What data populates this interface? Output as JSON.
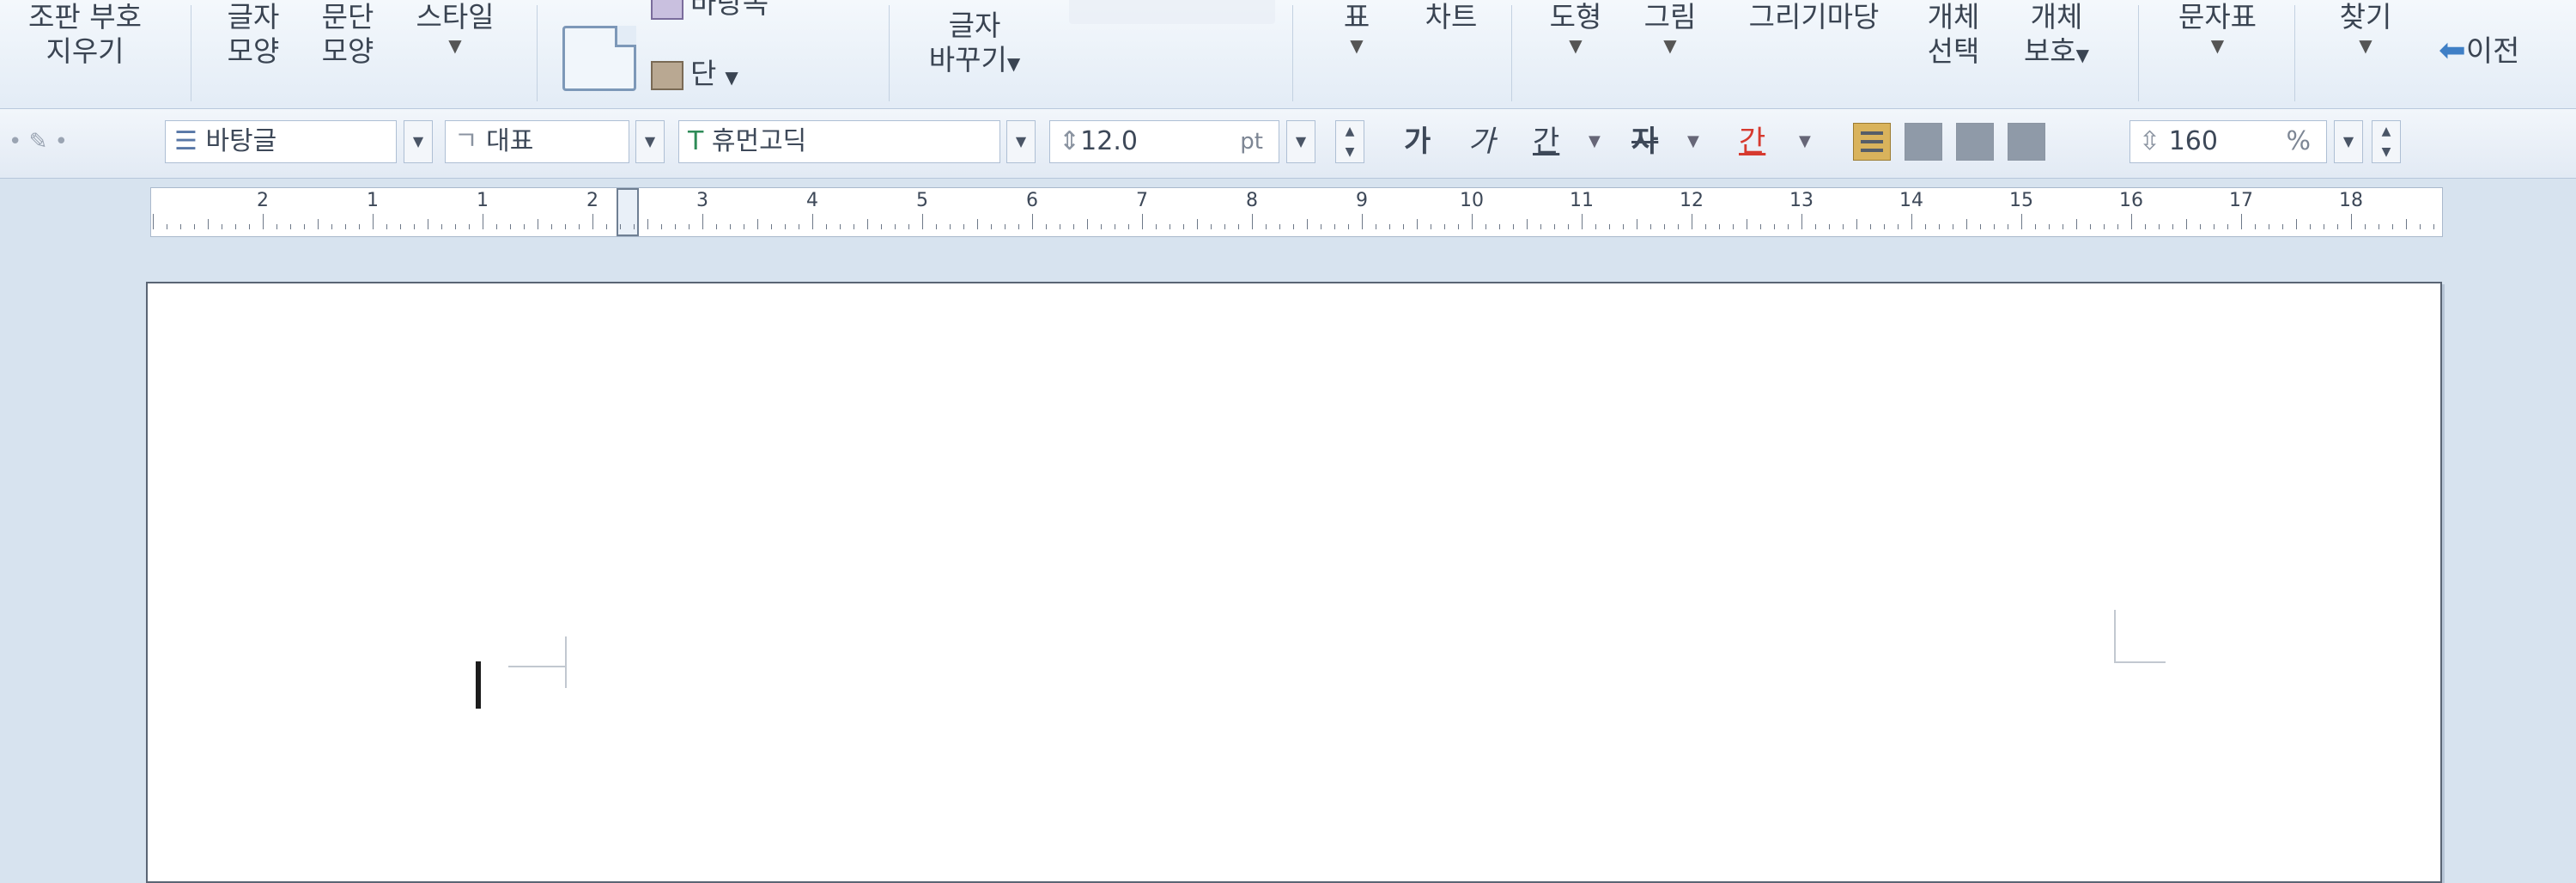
{
  "ribbon": {
    "clear_marks": [
      "조판 부호",
      "지우기"
    ],
    "char_shape": [
      "글자",
      "모양"
    ],
    "para_shape": [
      "문단",
      "모양"
    ],
    "style": "스타일",
    "background": "바탕쪽",
    "columns": "단",
    "change_char": [
      "글자",
      "바꾸기"
    ],
    "table": "표",
    "chart": "차트",
    "shape": "도형",
    "picture": "그림",
    "drawing_yard": "그리기마당",
    "select_object": [
      "개체",
      "선택"
    ],
    "protect_object": [
      "개체",
      "보호"
    ],
    "symbols": "문자표",
    "find": "찾기",
    "prev": "이전"
  },
  "toolbar": {
    "style_value": "바탕글",
    "lang_value": "대표",
    "font_value": "휴먼고딕",
    "size_value": "12.0",
    "size_unit": "pt",
    "bold": "가",
    "italic": "가",
    "underline": "간",
    "strike": "자",
    "color": "간",
    "line_spacing": "160",
    "line_spacing_unit": "%"
  },
  "ruler": {
    "numbers": [
      "2",
      "1",
      "1",
      "2",
      "3",
      "4",
      "5",
      "6",
      "7",
      "8",
      "9",
      "10",
      "11",
      "12",
      "13",
      "14",
      "15",
      "16",
      "17",
      "18"
    ]
  },
  "colors": {
    "accent_red": "#d63a2f",
    "active_align": "#d9b35c"
  }
}
